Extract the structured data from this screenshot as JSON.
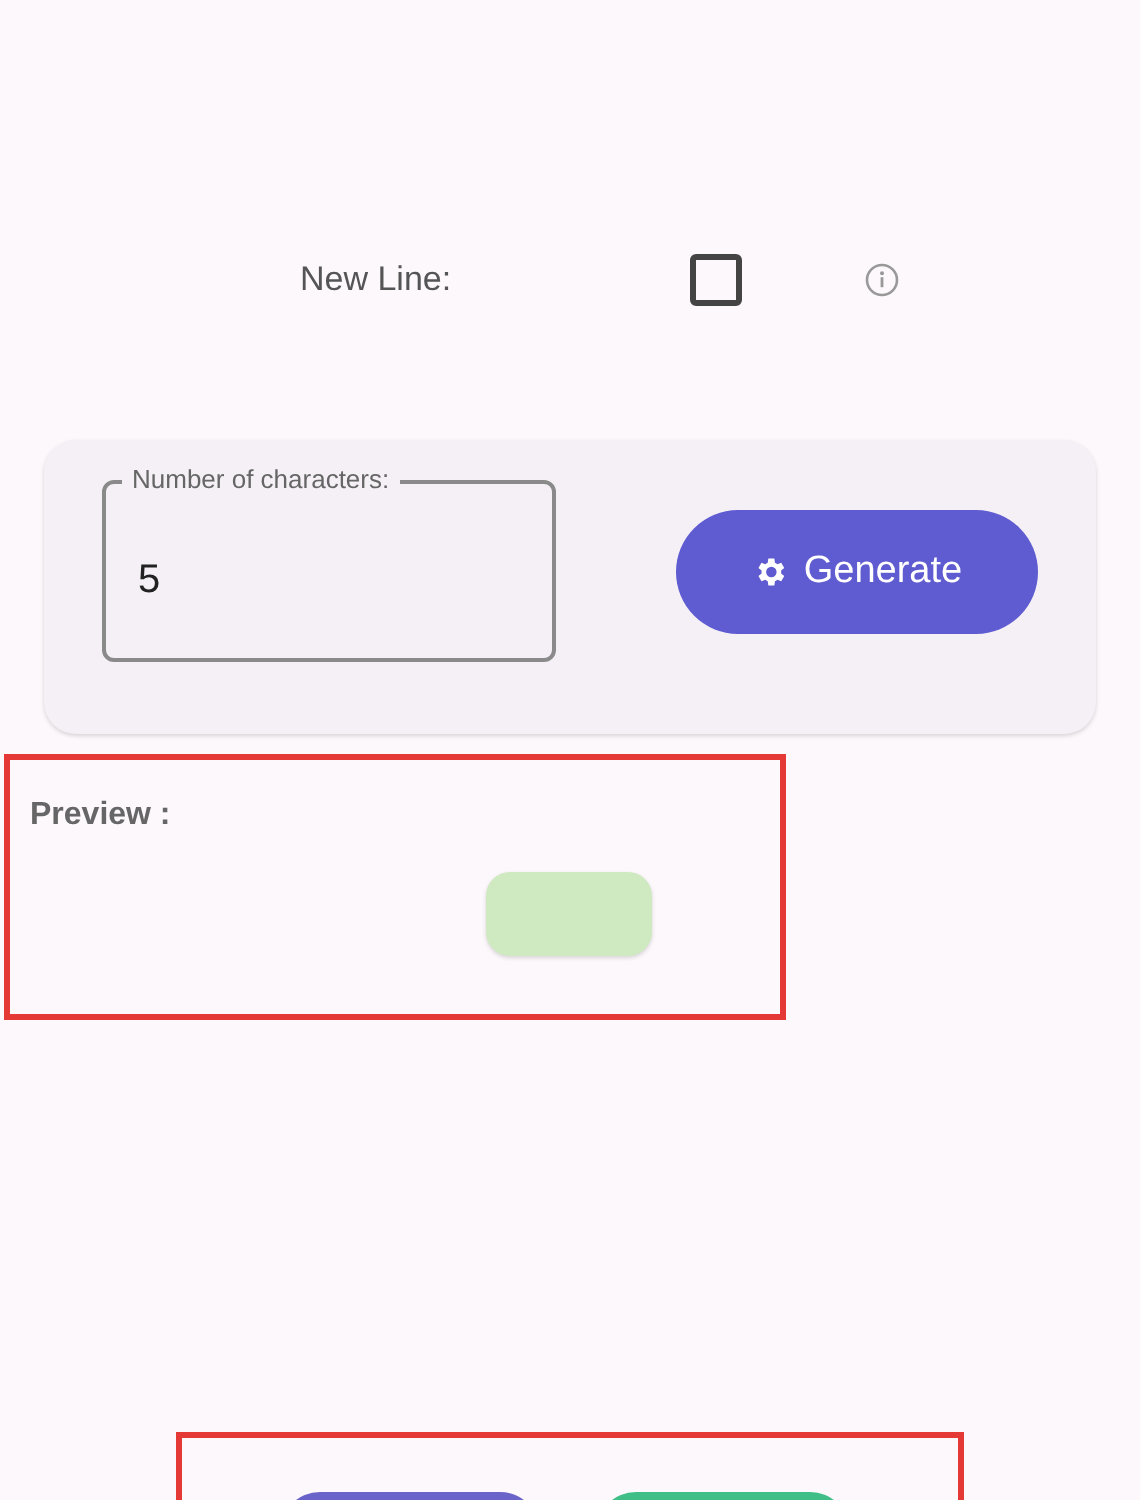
{
  "new_line": {
    "label": "New Line:",
    "checked": false
  },
  "number_field": {
    "label": "Number of characters:",
    "value": "5"
  },
  "generate_button": {
    "label": "Generate"
  },
  "preview": {
    "label": "Preview :"
  }
}
